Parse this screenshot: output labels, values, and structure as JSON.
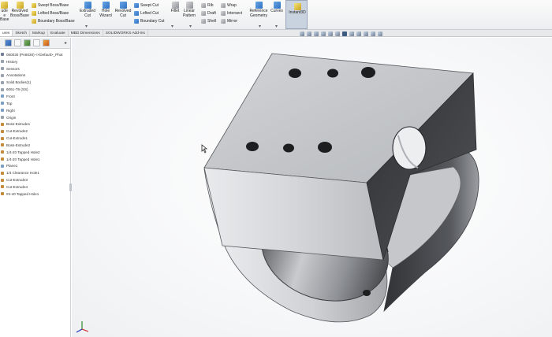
{
  "ribbon": {
    "left_cut_labels": [
      "ude",
      "e",
      "Base"
    ],
    "revolved_boss": "Revolved Boss/Base",
    "swept_boss": "Swept Boss/Base",
    "lofted_boss": "Lofted Boss/Base",
    "boundary_boss": "Boundary Boss/Base",
    "extruded_cut": "Extruded Cut",
    "hole_wizard": "Hole Wizard",
    "revolved_cut": "Revolved Cut",
    "swept_cut": "Swept Cut",
    "lofted_cut": "Lofted Cut",
    "boundary_cut": "Boundary Cut",
    "fillet": "Fillet",
    "linear_pattern": "Linear Pattern",
    "rib": "Rib",
    "draft": "Draft",
    "shell": "Shell",
    "wrap": "Wrap",
    "intersect": "Intersect",
    "mirror": "Mirror",
    "reference_geometry": "Reference Geometry",
    "curves": "Curves",
    "instant3d": "Instant3D"
  },
  "tabs": [
    "ures",
    "Sketch",
    "Markup",
    "Evaluate",
    "MBD Dimensions",
    "SOLIDWORKS Add-Ins"
  ],
  "active_tab": 0,
  "tree": {
    "root": "050030 (PA8030) <<Default>_Phot",
    "items": [
      {
        "label": "History",
        "kind": "folder"
      },
      {
        "label": "Sensors",
        "kind": "folder"
      },
      {
        "label": "Annotations",
        "kind": "folder"
      },
      {
        "label": "Solid Bodies(1)",
        "kind": "folder"
      },
      {
        "label": "6061-T6 (SS)",
        "kind": "folder"
      },
      {
        "label": "Front",
        "kind": "plane"
      },
      {
        "label": "Top",
        "kind": "plane"
      },
      {
        "label": "Right",
        "kind": "plane"
      },
      {
        "label": "Origin",
        "kind": "folder"
      },
      {
        "label": "Boss-Extrude1",
        "kind": "feat"
      },
      {
        "label": "Cut-Extrude2",
        "kind": "feat"
      },
      {
        "label": "Cut-Extrude1",
        "kind": "feat"
      },
      {
        "label": "Boss-Extrude2",
        "kind": "feat"
      },
      {
        "label": "1/4-20 Tapped Hole2",
        "kind": "feat"
      },
      {
        "label": "1/4-20 Tapped Hole1",
        "kind": "feat"
      },
      {
        "label": "Plane1",
        "kind": "plane"
      },
      {
        "label": "1/4 Clearance Hole1",
        "kind": "feat"
      },
      {
        "label": "Cut-Extrude3",
        "kind": "feat"
      },
      {
        "label": "Cut-Extrude4",
        "kind": "feat"
      },
      {
        "label": "#4-40 Tapped Hole1",
        "kind": "feat"
      }
    ]
  },
  "colors": {
    "ribbon_bg": "#eceef0",
    "panel_bg": "#ffffff",
    "part_light": "#e6e7e9",
    "part_mid": "#a7aaae",
    "part_dark": "#3b3d40",
    "accent": "#2d6fc0"
  },
  "icons": [
    "extrude-icon",
    "revolve-icon",
    "fillet-icon",
    "pattern-icon",
    "rib-icon",
    "draft-icon",
    "shell-icon",
    "wrap-icon",
    "reference-geometry-icon",
    "curves-icon",
    "instant3d-icon",
    "feature-manager-icon",
    "property-manager-icon",
    "configuration-manager-icon",
    "dimxpert-icon",
    "display-manager-icon",
    "zoom-to-fit-icon",
    "view-orientation-icon",
    "display-style-icon",
    "triad-icon",
    "cursor-icon"
  ]
}
